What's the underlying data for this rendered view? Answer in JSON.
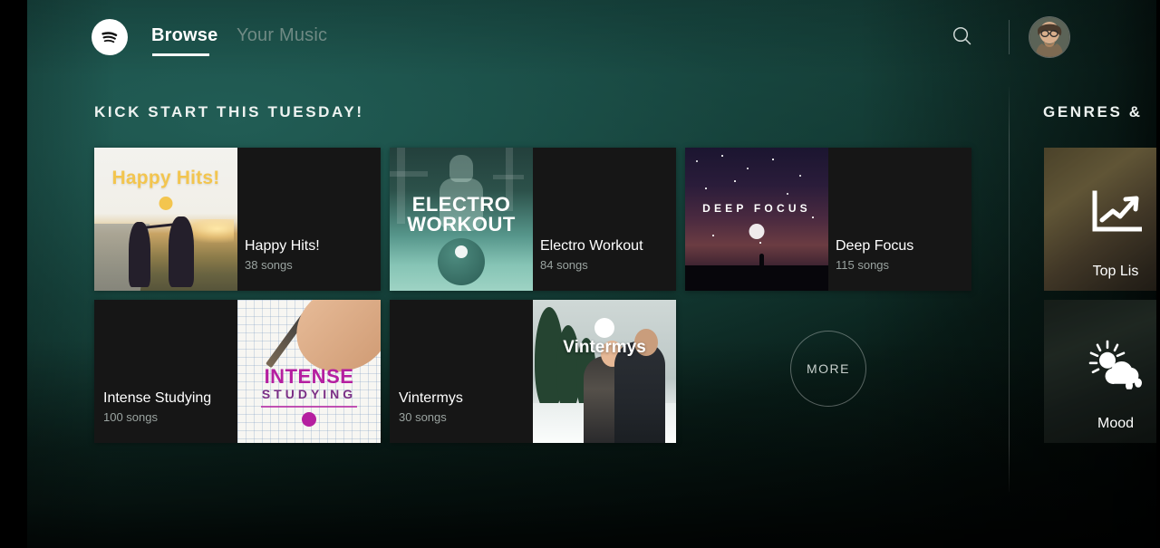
{
  "header": {
    "logo_icon": "spotify-logo-icon",
    "tabs": [
      {
        "label": "Browse",
        "active": true
      },
      {
        "label": "Your Music",
        "active": false
      }
    ],
    "search_icon": "search-icon",
    "avatar_label": "User profile"
  },
  "section": {
    "title": "KICK START THIS TUESDAY!",
    "more_label": "MORE"
  },
  "cards": [
    {
      "title": "Happy Hits!",
      "songs": "38 songs",
      "art_text": "Happy Hits!",
      "layout": "image-left"
    },
    {
      "title": "Electro Workout",
      "songs": "84 songs",
      "art_text": "ELECTRO WORKOUT",
      "layout": "image-left"
    },
    {
      "title": "Deep Focus",
      "songs": "115 songs",
      "art_text": "DEEP FOCUS",
      "layout": "image-left"
    },
    {
      "title": "Intense Studying",
      "songs": "100 songs",
      "art_text": "INTENSE STUDYING",
      "layout": "image-right"
    },
    {
      "title": "Vintermys",
      "songs": "30 songs",
      "art_text": "Vintermys",
      "layout": "image-right"
    }
  ],
  "genres": {
    "title": "GENRES &",
    "tiles": [
      {
        "label": "Top Lis",
        "icon": "trending-chart-icon"
      },
      {
        "label": "Mood",
        "icon": "sun-cloud-rain-icon"
      }
    ]
  },
  "art": {
    "electro_line1": "ELECTRO",
    "electro_line2": "WORKOUT",
    "intense_line1": "INTENSE",
    "intense_line2": "STUDYING"
  },
  "colors": {
    "background_teal": "#1d5b53",
    "card_dark": "#161616",
    "text_primary": "#ffffff",
    "text_secondary": "#9aa3a0",
    "tab_inactive": "#6f8a84"
  }
}
